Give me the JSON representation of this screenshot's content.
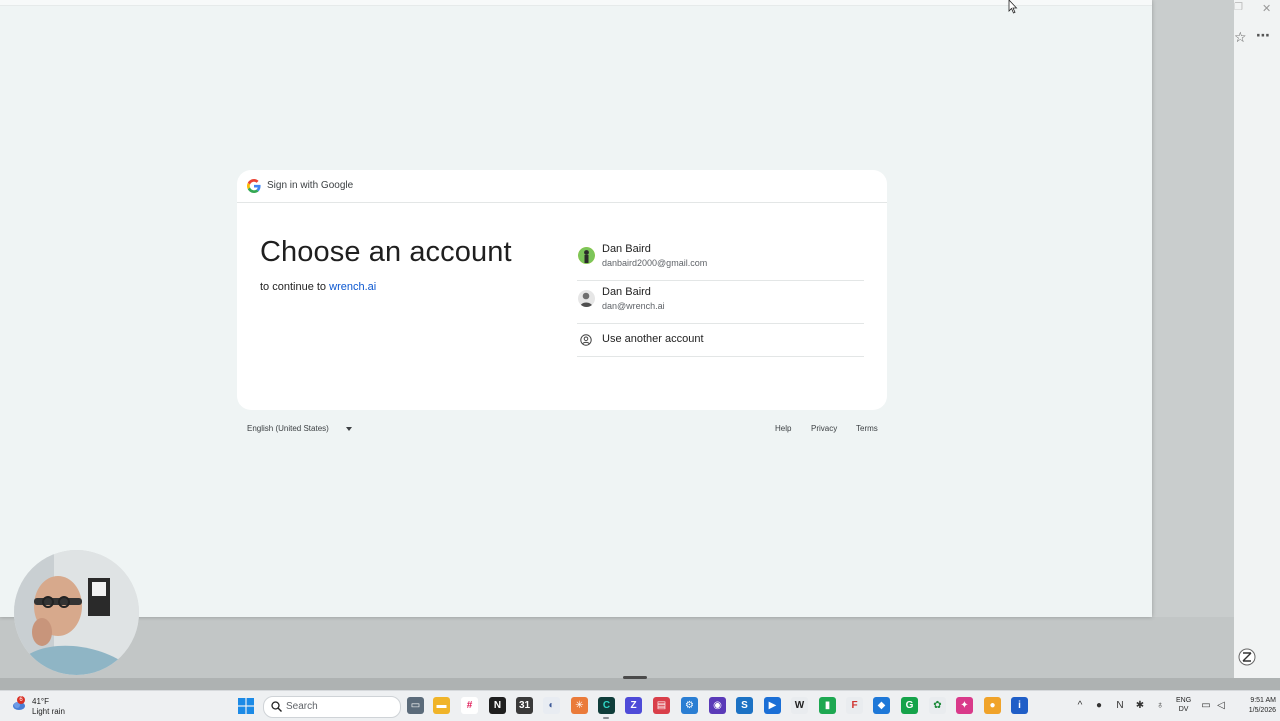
{
  "popup": {
    "card": {
      "header_title": "Sign in with Google",
      "heading": "Choose an account",
      "continue_prefix": "to continue to",
      "continue_site": "wrench.ai",
      "accounts": [
        {
          "name": "Dan Baird",
          "email": "danbaird2000@gmail.com"
        },
        {
          "name": "Dan Baird",
          "email": "dan@wrench.ai"
        }
      ],
      "use_another_label": "Use another account"
    },
    "footer": {
      "language": "English (United States)",
      "links": [
        "Help",
        "Privacy",
        "Terms"
      ]
    }
  },
  "taskbar": {
    "weather": {
      "temp": "41°F",
      "condition": "Light rain",
      "badge": "6"
    },
    "search_placeholder": "Search",
    "tray": {
      "lang_line1": "ENG",
      "lang_line2": "DV",
      "time": "9:51 AM",
      "date": "1/5/2026"
    }
  },
  "colors": {
    "link": "#0b57d0",
    "page_bg": "#eff4f4",
    "card_bg": "#ffffff"
  },
  "icons": [
    "google-g-icon",
    "account-circle-icon",
    "caret-down-icon",
    "windows-start-icon",
    "search-icon",
    "star-icon",
    "more-icon"
  ]
}
